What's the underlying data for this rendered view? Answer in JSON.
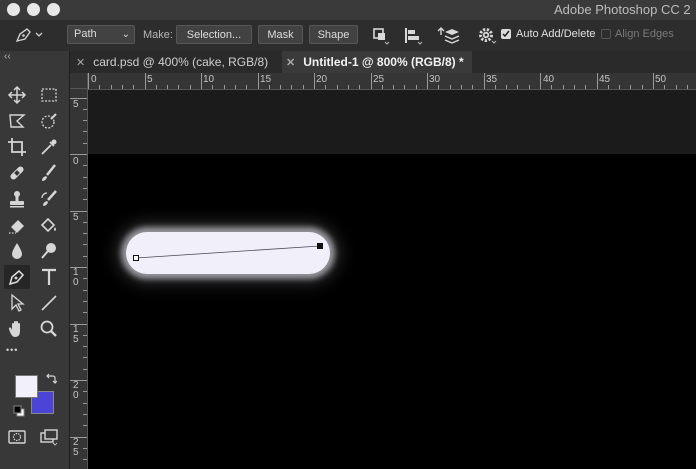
{
  "app": {
    "title": "Adobe Photoshop CC 2"
  },
  "options_bar": {
    "mode": "Path",
    "make_label": "Make:",
    "selection_btn": "Selection...",
    "mask_btn": "Mask",
    "shape_btn": "Shape",
    "auto_add_delete_label": "Auto Add/Delete",
    "auto_add_delete_checked": true,
    "align_edges_label": "Align Edges",
    "align_edges_checked": false
  },
  "tabs": [
    {
      "label": "card.psd @ 400% (cake, RGB/8)",
      "active": false
    },
    {
      "label": "Untitled-1 @ 800% (RGB/8) *",
      "active": true
    }
  ],
  "toolbox": {
    "collapse_glyph": "‹‹",
    "foreground_color": "#f2f0fb",
    "background_color": "#4b44d6",
    "more_glyph": "•••",
    "tools": [
      "move-icon",
      "marquee-icon",
      "lasso-icon",
      "quick-select-icon",
      "crop-icon",
      "eyedropper-icon",
      "healing-icon",
      "brush-icon",
      "stamp-icon",
      "history-brush-icon",
      "eraser-icon",
      "paint-bucket-icon",
      "blur-icon",
      "dodge-icon",
      "pen-icon",
      "type-icon",
      "path-select-icon",
      "line-icon",
      "hand-icon",
      "zoom-icon",
      "quick-mask-icon",
      "screen-mode-icon"
    ]
  },
  "rulers": {
    "horizontal": [
      "0",
      "5",
      "10",
      "15",
      "20",
      "25",
      "30",
      "35",
      "40",
      "45",
      "50"
    ],
    "vertical": [
      "5",
      "0",
      "5",
      "1\n0",
      "1\n5",
      "2\n0",
      "2\n5"
    ]
  },
  "canvas": {
    "background": "#000000",
    "stroke_color": "#f1f0fa",
    "path_color": "#4a4a5a"
  }
}
